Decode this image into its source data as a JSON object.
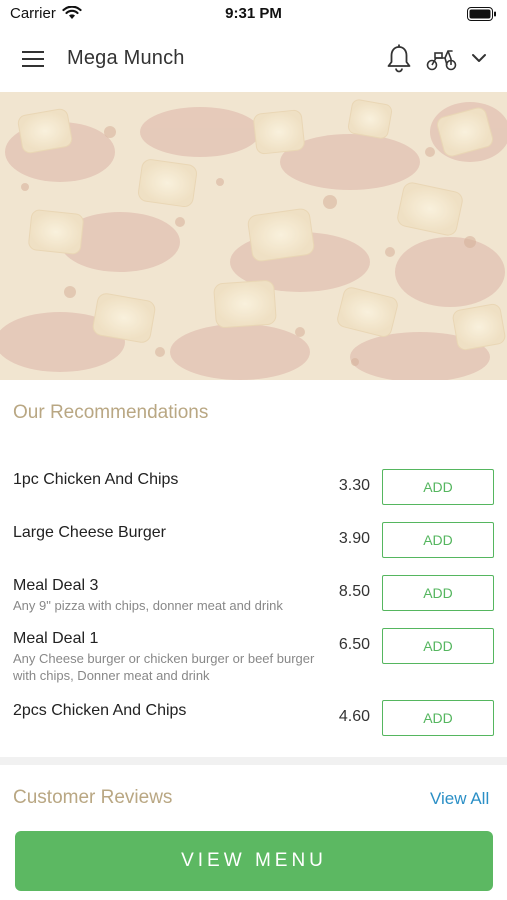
{
  "status_bar": {
    "carrier": "Carrier",
    "time": "9:31 PM"
  },
  "header": {
    "title": "Mega Munch",
    "icons": [
      "hamburger-menu-icon",
      "bell-icon",
      "scooter-icon",
      "chevron-down-icon"
    ]
  },
  "recommendations": {
    "title": "Our Recommendations",
    "items": [
      {
        "name": "1pc Chicken And Chips",
        "description": "",
        "price": "3.30",
        "action": "ADD"
      },
      {
        "name": "Large Cheese Burger",
        "description": "",
        "price": "3.90",
        "action": "ADD"
      },
      {
        "name": "Meal Deal 3",
        "description": "Any 9\" pizza with chips, donner meat and drink",
        "price": "8.50",
        "action": "ADD"
      },
      {
        "name": "Meal Deal 1",
        "description": "Any Cheese burger or chicken burger or beef burger with chips, Donner meat and drink",
        "price": "6.50",
        "action": "ADD"
      },
      {
        "name": "2pcs Chicken And Chips",
        "description": "",
        "price": "4.60",
        "action": "ADD"
      }
    ]
  },
  "reviews": {
    "title": "Customer Reviews",
    "view_all": "View All"
  },
  "cta": {
    "label": "VIEW MENU"
  },
  "colors": {
    "accent_green": "#5cb862",
    "section_title": "#b9a783",
    "link_blue": "#2b8fc6"
  }
}
